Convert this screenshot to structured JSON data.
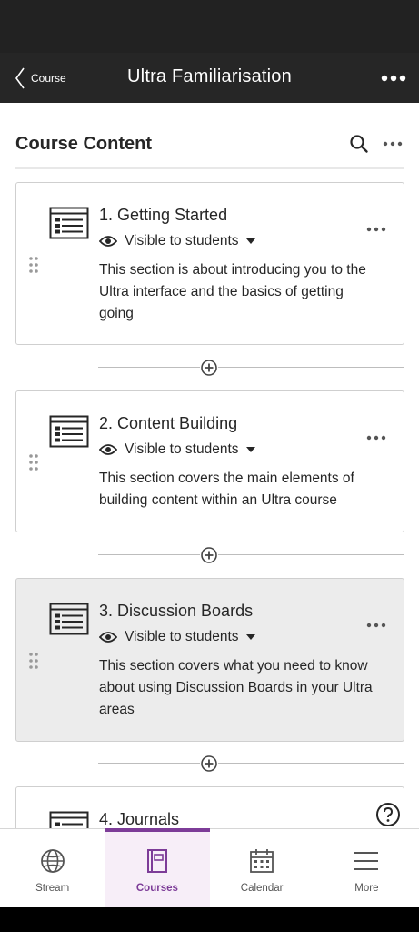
{
  "nav": {
    "back_label": "Course",
    "title": "Ultra Familiarisation"
  },
  "content": {
    "title": "Course Content"
  },
  "cards": [
    {
      "title": "1. Getting Started",
      "visibility": "Visible to students",
      "description": "This section is about introducing you to the Ultra interface and the basics of getting going"
    },
    {
      "title": "2. Content Building",
      "visibility": "Visible to students",
      "description": "This section covers the main elements of building content within an Ultra course"
    },
    {
      "title": "3. Discussion Boards",
      "visibility": "Visible to students",
      "description": "This section covers what you need to know about using Discussion Boards in your Ultra areas"
    },
    {
      "title": "4. Journals"
    }
  ],
  "tabs": [
    {
      "label": "Stream",
      "icon": "globe-icon"
    },
    {
      "label": "Courses",
      "icon": "courses-icon",
      "active": true
    },
    {
      "label": "Calendar",
      "icon": "calendar-icon"
    },
    {
      "label": "More",
      "icon": "menu-icon"
    }
  ],
  "colors": {
    "accent": "#7d3c98",
    "nav_bg": "#262626",
    "text": "#262626",
    "highlight_card": "#ececec"
  }
}
